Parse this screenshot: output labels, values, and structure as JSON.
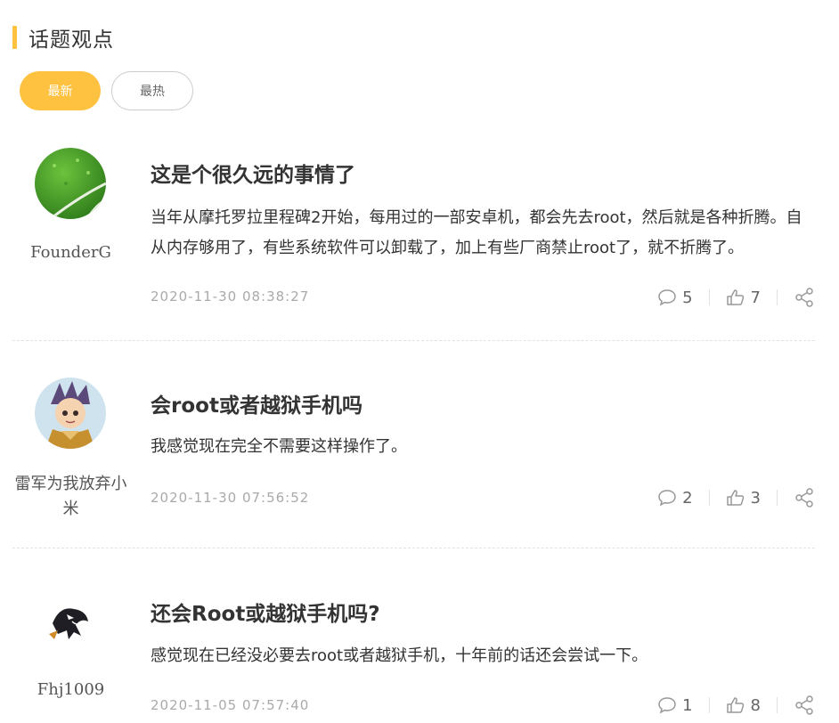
{
  "section": {
    "title": "话题观点"
  },
  "tabs": {
    "latest": "最新",
    "hottest": "最热"
  },
  "colors": {
    "accent": "#ffc240",
    "muted_text": "#aaaaaa"
  },
  "posts": [
    {
      "author": "FounderG",
      "title": "这是个很久远的事情了",
      "body": "当年从摩托罗拉里程碑2开始，每用过的一部安卓机，都会先去root，然后就是各种折腾。自从内存够用了，有些系统软件可以卸载了，加上有些厂商禁止root了，就不折腾了。",
      "time": "2020-11-30 08:38:27",
      "comments": "5",
      "likes": "7"
    },
    {
      "author": "雷军为我放弃小米",
      "title": "会root或者越狱手机吗",
      "body": "我感觉现在完全不需要这样操作了。",
      "time": "2020-11-30 07:56:52",
      "comments": "2",
      "likes": "3"
    },
    {
      "author": "Fhj1009",
      "title": "还会Root或越狱手机吗?",
      "body": "感觉现在已经没必要去root或者越狱手机，十年前的话还会尝试一下。",
      "time": "2020-11-05 07:57:40",
      "comments": "1",
      "likes": "8"
    }
  ]
}
